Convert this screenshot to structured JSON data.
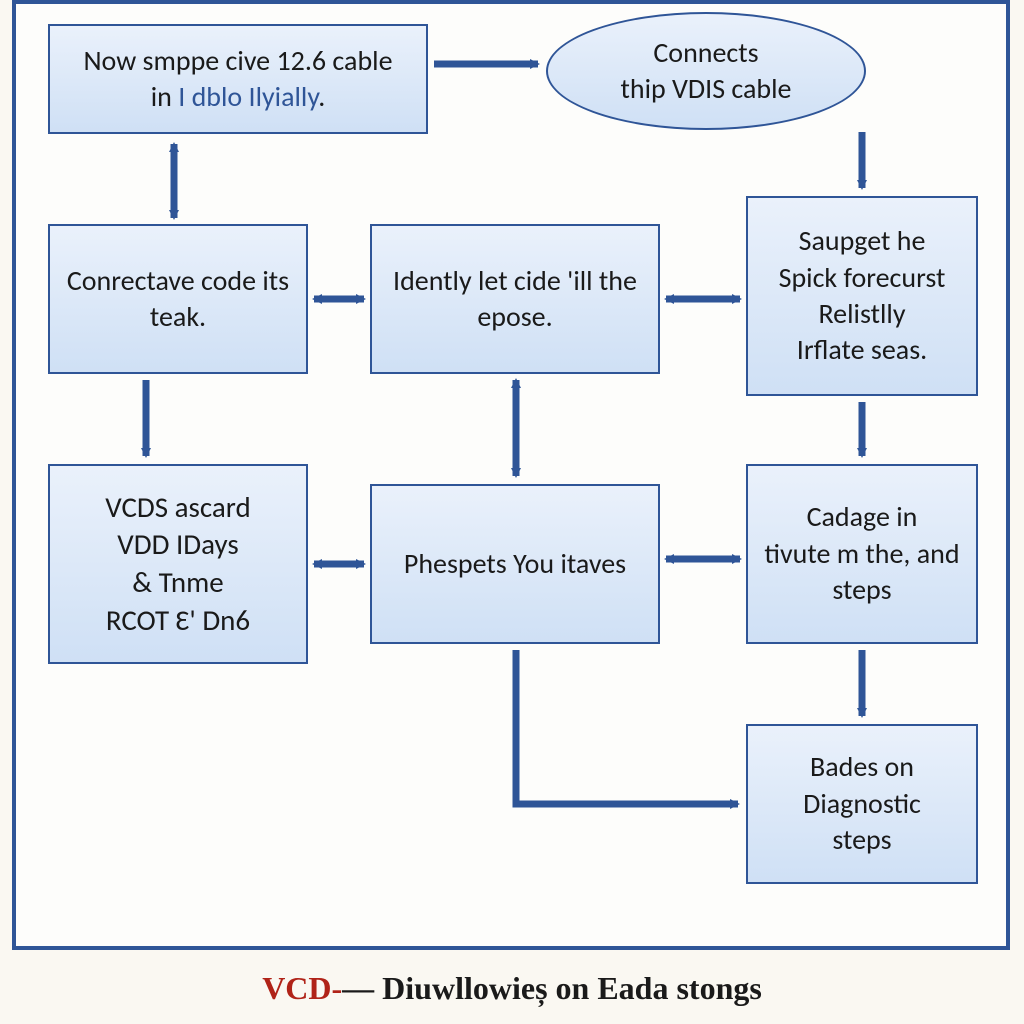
{
  "nodes": {
    "top_left": {
      "line1": "Now smppe cive 12.6 cable",
      "line2_pre": "in ",
      "line2_accent": "I dblo Ilyially",
      "line2_post": "."
    },
    "top_ellipse": {
      "line1": "Connects",
      "line2": "thip VDIS cable"
    },
    "mid_left": "Conrectave code its teak.",
    "mid_center": "Idently let cide 'ill the epose.",
    "mid_right": {
      "line1": "Saupget he",
      "line2": "Spick forecurst",
      "line3": "Relistlly",
      "line4": "Irflate seas."
    },
    "low_left": {
      "line1": "VCDS ascard",
      "line2": "VDD IDays",
      "line3": "& Tnme",
      "line4": "RCOT Ɛ' Dn6"
    },
    "low_center": "Phespets You itaves",
    "low_right": {
      "line1": "Cadage in",
      "line2": "tivute m the, and",
      "line3": "steps"
    },
    "bottom_right": {
      "line1": "Bades on",
      "line2": "Diagnostic",
      "line3": "steps"
    }
  },
  "footer": {
    "red": "VCD-",
    "rest": "— Diuwllowieș on Eada stongs"
  },
  "colors": {
    "stroke": "#2f5597",
    "fill_arrow": "#2f5597"
  }
}
